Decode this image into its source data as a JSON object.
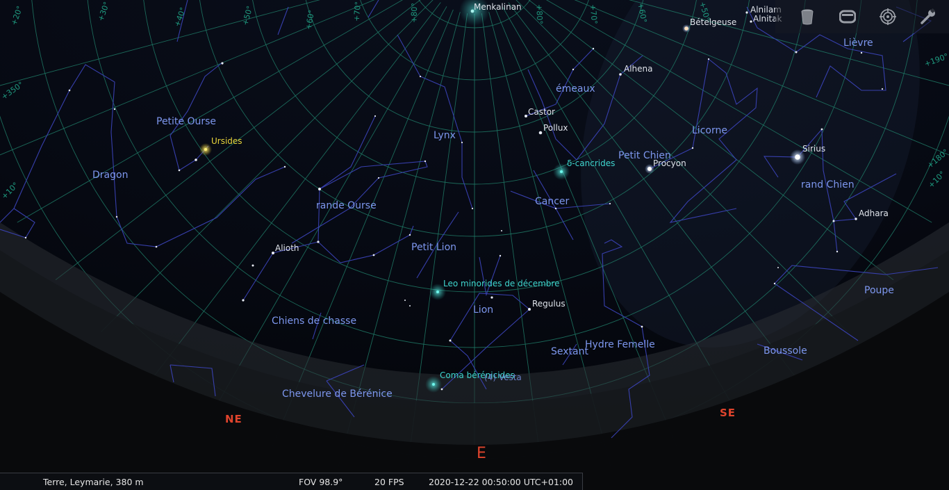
{
  "status_bar": {
    "location": "Terre, Leymarie, 380 m",
    "fov": "FOV 98.9°",
    "fps": "20 FPS",
    "datetime": "2020-12-22 00:50:00 UTC+01:00"
  },
  "toolbar": {
    "buttons": [
      "trash-icon",
      "window-icon",
      "target-icon",
      "wrench-icon"
    ]
  },
  "grid_labels": [
    "+20°",
    "+30°",
    "+40°",
    "+50°",
    "+60°",
    "+70°",
    "+80°",
    "+80°",
    "+70°",
    "+60°",
    "+50°",
    "+350°",
    "+10°",
    "+190°",
    "+180°",
    "+10°"
  ],
  "constellations": {
    "petite_ourse": "Petite Ourse",
    "dragon": "Dragon",
    "grande_ourse": "rande Ourse",
    "lynx": "Lynx",
    "gemeaux": "émeaux",
    "licorne": "Licorne",
    "lievre": "Lièvre",
    "petit_chien": "Petit Chien",
    "grand_chien": "rand Chien",
    "cancer": "Cancer",
    "petit_lion": "Petit Lion",
    "lion": "Lion",
    "chiens_de_chasse": "Chiens de chasse",
    "sextant": "Sextant",
    "hydre_femelle": "Hydre Femelle",
    "poupe": "Poupe",
    "boussole": "Boussole",
    "chevelure": "Chevelure de Bérénice"
  },
  "stars": {
    "menkalinan": "Menkalinan",
    "betelgeuse": "Bételgeuse",
    "alnilam": "Alnilam",
    "alnitak": "Alnitak",
    "alhena": "Alhena",
    "castor": "Castor",
    "pollux": "Pollux",
    "procyon": "Procyon",
    "sirius": "Sirius",
    "adhara": "Adhara",
    "alioth": "Alioth",
    "regulus": "Regulus"
  },
  "meteor_showers": {
    "ursides": "Ursides",
    "delta_cancrides": "δ-cancrides",
    "leo_minorides": "Leo minorides de décembre",
    "coma_berenicides": "Coma bérénicides"
  },
  "asteroids": {
    "vesta": "(4) Vesta"
  },
  "cardinals": {
    "ne": "NE",
    "e": "E",
    "se": "SE"
  },
  "colors": {
    "sky": "#05070d",
    "constellation_lines": "#3a42b5",
    "constellation_names": "#7d97ee",
    "grid": "#1f7a66",
    "meteor_labels": "#3fd6cf",
    "cardinal": "#e0442d"
  }
}
